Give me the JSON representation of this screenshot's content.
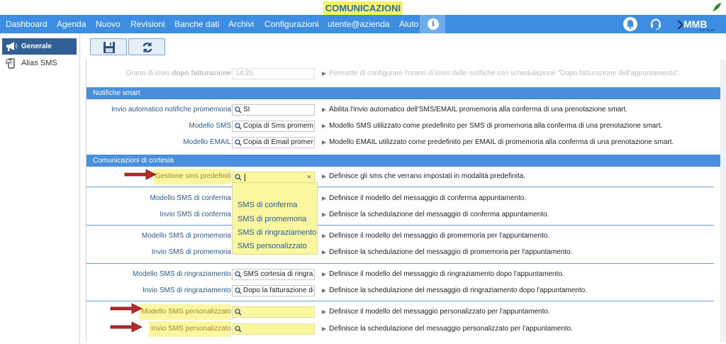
{
  "app": {
    "title": "COMUNICAZIONI"
  },
  "nav": {
    "items": [
      "Dashboard",
      "Agenda",
      "Nuovo",
      "Revisioni",
      "Banche dati",
      "Archivi",
      "Configurazioni",
      "utente@azienda",
      "Aiuto"
    ],
    "info_label": "i",
    "logo_text": "MMB",
    "logo_sub": "SOFTWARE"
  },
  "sidebar": {
    "items": [
      {
        "label": "Generale",
        "icon": "megaphone-icon",
        "active": true
      },
      {
        "label": "Alias SMS",
        "icon": "sms-phone-icon",
        "active": false
      }
    ]
  },
  "toolbar": {
    "save_icon": "floppy-disk-icon",
    "refresh_icon": "refresh-icon"
  },
  "rows_top": {
    "orario": {
      "label_prefix": "Orario di invio ",
      "label_bold": "dopo fatturazione",
      "value": "14:25",
      "desc": "Permette di configurare l'orario di invio delle notifiche con schedulazione \"Dopo fatturazione dell'appuntamento\"."
    }
  },
  "section_smart": {
    "title": "Notifiche smart",
    "rows": [
      {
        "label": "Invio automatico notifiche promemoria",
        "value": "SI",
        "desc": "Abilita l'invio automatico dell'SMS/EMAIL promemoria alla conferma di una prenotazione smart."
      },
      {
        "label": "Modello SMS",
        "value": "Copia di Sms promemoria",
        "desc": "Modello SMS utilizzato come predefinito per SMS di promemoria alla conferma di una prenotazione smart."
      },
      {
        "label": "Modello EMAIL",
        "value": "Copia di Email promemoria",
        "desc": "Modello EMAIL utilizzato come predefinito per EMAIL di promemoria alla conferma di una prenotazione smart."
      }
    ]
  },
  "section_cortesia": {
    "title": "Comunicazioni di cortesia",
    "gestione": {
      "label": "Gestione sms predefiniti",
      "value": "",
      "desc": "Definisce gli sms che verrano impostati in modalità predefinita."
    },
    "rows": [
      {
        "label": "Modello SMS di conferma",
        "value": "",
        "desc": "Definisce il modello del messaggio di conferma appuntamento."
      },
      {
        "label": "Invio SMS di conferma",
        "value": "",
        "desc": "Definisce la schedulazione del messaggio di conferma appuntamento."
      },
      {
        "label": "Modello SMS di promemoria",
        "value": "",
        "desc": "Definisce il modello del messaggio di promemoria per l'appuntamento."
      },
      {
        "label": "Invio SMS di promemoria",
        "value": "",
        "desc": "Definisce la schedulazione del messaggio di promemoria per l'appuntamento."
      },
      {
        "label": "Modello SMS di ringraziamento",
        "value": "SMS cortesia di ringraziamento",
        "desc": "Definisce il modello del messaggio di ringraziamento dopo l'appuntamento."
      },
      {
        "label": "Invio SMS di ringraziamento",
        "value": "Dopo la fatturazione dell'appuntamento",
        "desc": "Definisce la schedulazione del messaggio di ringraziamento dopo l'appuntamento."
      },
      {
        "label": "Modello SMS personalizzato",
        "value": "",
        "desc": "Definisce il modello del messaggio personalizzato per l'appuntamento."
      },
      {
        "label": "Invio SMS personalizzato",
        "value": "",
        "desc": "Definisce la schedulazione del messaggio personalizzato per l'appuntamento."
      }
    ]
  },
  "dropdown": {
    "search_value": "",
    "clear_label": "×",
    "options": [
      "SMS di conferma",
      "SMS di promemoria",
      "SMS di ringraziamento",
      "SMS personalizzato"
    ]
  },
  "colors": {
    "navbar": "#3d8ee2",
    "section": "#4a8fdc",
    "highlight": "#fbf7a0",
    "title_chip": "#f7f45e",
    "arrow": "#b52a2a"
  }
}
